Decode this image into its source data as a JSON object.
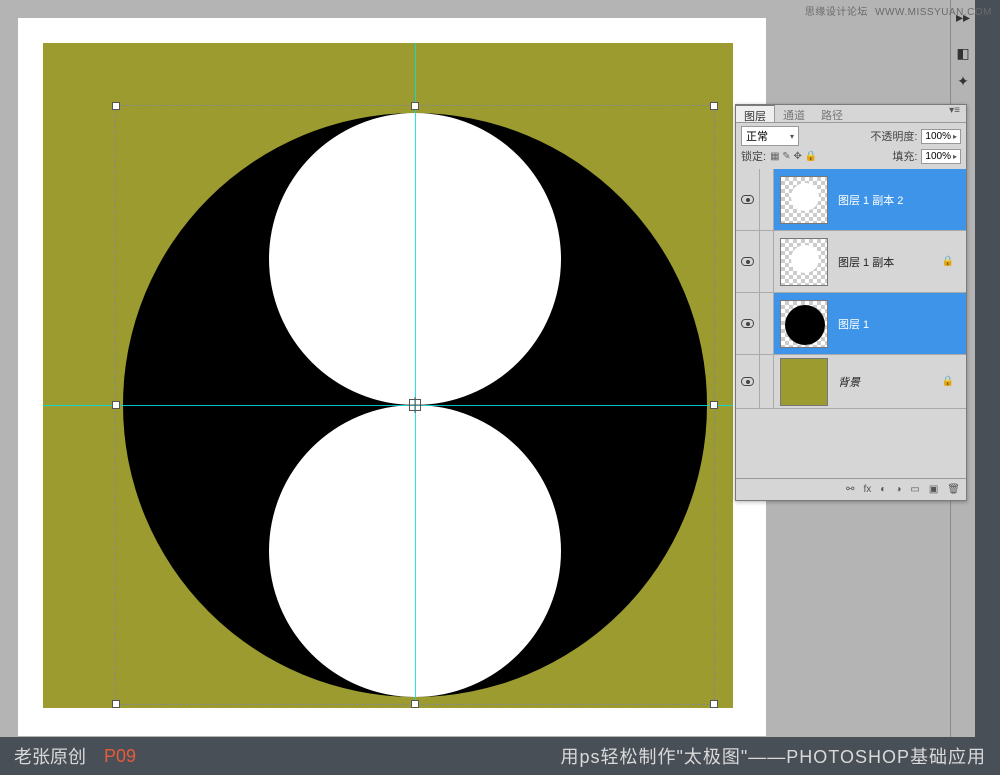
{
  "watermark": {
    "site": "思缘设计论坛",
    "url": "WWW.MISSYUAN.COM"
  },
  "panel": {
    "tabs": [
      "图层",
      "通道",
      "路径"
    ],
    "blend_label": "正常",
    "opacity_label": "不透明度:",
    "opacity_value": "100%",
    "lock_label": "锁定:",
    "fill_label": "填充:",
    "fill_value": "100%"
  },
  "layers": [
    {
      "name": "图层 1 副本 2",
      "selected": true,
      "type": "white-circle",
      "locked": false
    },
    {
      "name": "图层 1 副本",
      "selected": false,
      "type": "white-circle",
      "locked": true
    },
    {
      "name": "图层 1",
      "selected": true,
      "type": "black-circle",
      "locked": false
    },
    {
      "name": "背景",
      "selected": false,
      "type": "bg",
      "locked": true
    }
  ],
  "footer": {
    "author": "老张原创",
    "page": "P09",
    "title": "用ps轻松制作\"太极图\"——PHOTOSHOP基础应用"
  }
}
